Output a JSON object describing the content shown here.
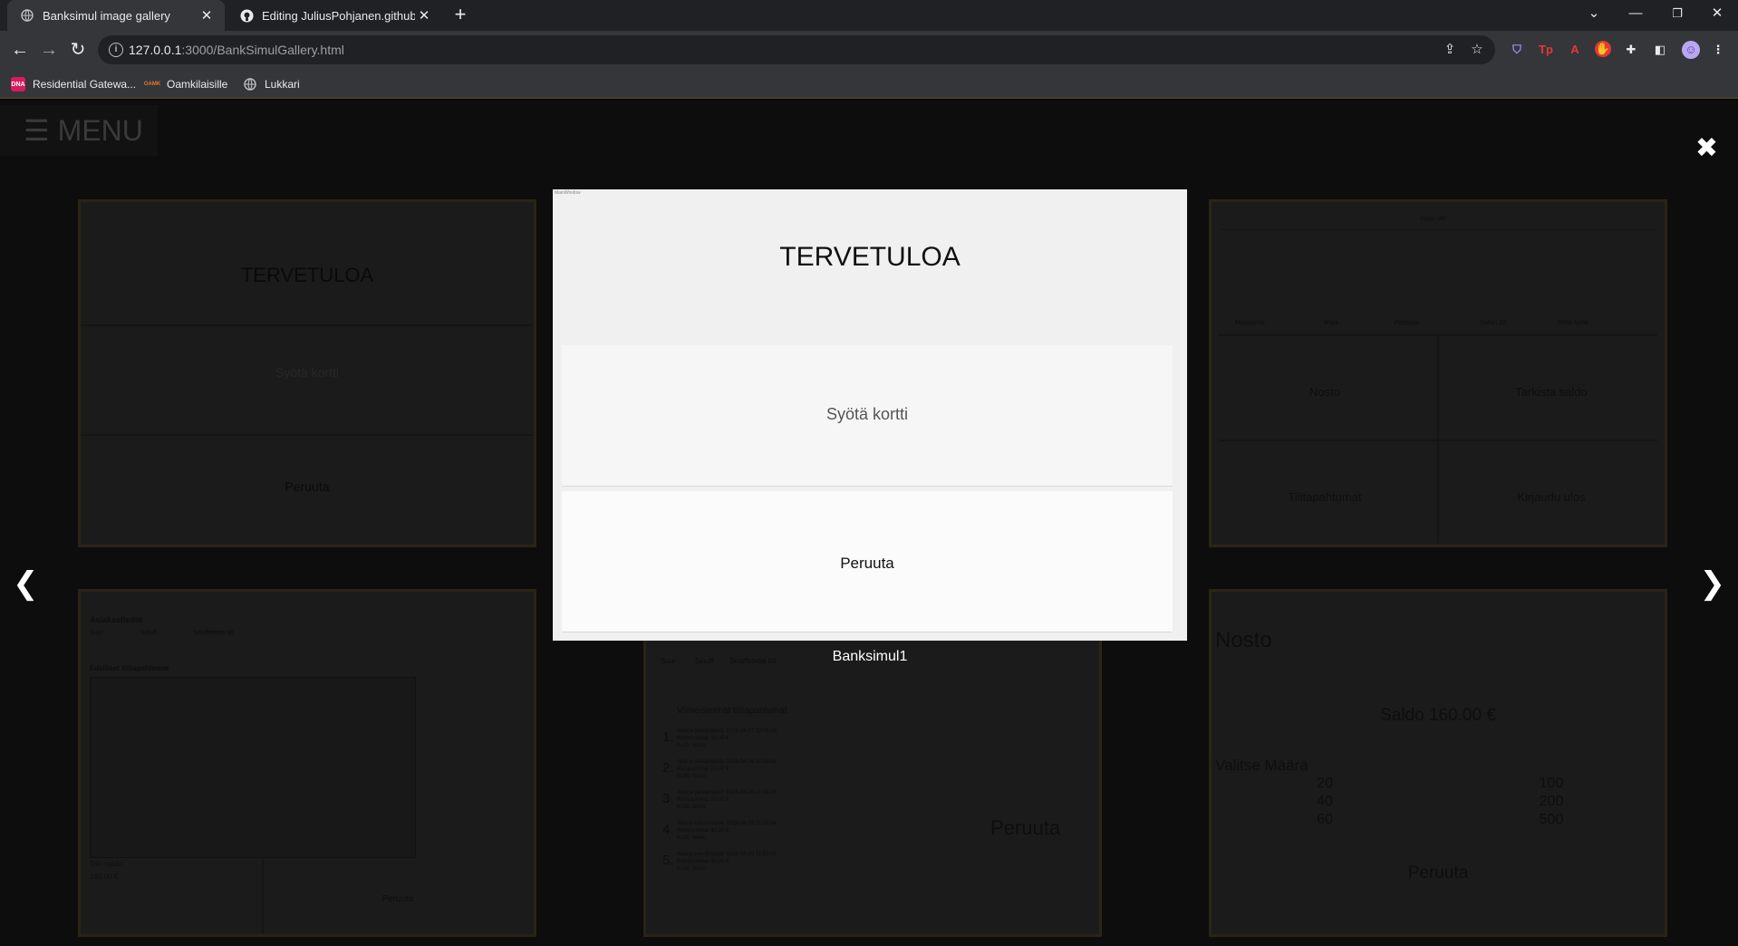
{
  "browser": {
    "tabs": [
      {
        "title": "Banksimul image gallery",
        "icon": "globe-icon"
      },
      {
        "title": "Editing JuliusPohjanen.github.io/",
        "icon": "github-icon"
      }
    ],
    "url_host": "127.0.0.1",
    "url_rest": ":3000/BankSimulGallery.html",
    "bookmarks": [
      {
        "label": "Residential Gatewa...",
        "icon": "DNA",
        "color": "#d81b60"
      },
      {
        "label": "Oamkilaisille",
        "icon": "OAMK",
        "color": "#e6762d"
      },
      {
        "label": "Lukkari",
        "icon": "globe-icon",
        "color": "#bdc1c6"
      }
    ]
  },
  "page": {
    "menu_label": "☰ MENU",
    "close_icon": "✖",
    "prev_icon": "❮",
    "next_icon": "❯",
    "caption": "Banksimul1"
  },
  "modal": {
    "window_title": "MainWindow",
    "title": "TERVETULOA",
    "insert_card": "Syötä kortti",
    "cancel": "Peruuta"
  },
  "thumbs": {
    "t1": {
      "title": "TERVETULOA",
      "insert": "Syötä kortti",
      "cancel": "Peruuta"
    },
    "t2": {
      "header": "Saldo: 160",
      "buttons": [
        "Nosto",
        "Tarkista saldo",
        "Tilitapahtumat",
        "Kirjaudu ulos"
      ],
      "weekdays": [
        "Maanantai",
        "Maja",
        "Perjantai",
        "Sallan 25",
        "Delta kortti"
      ]
    },
    "t3": {
      "title": "Asiakastiedot",
      "fields": [
        "Suur",
        "Sinuff",
        "Smsffeteba 60"
      ],
      "subtitle": "Edelliset tilitapahtumat",
      "balance_label": "Tilin saldo:",
      "balance": "160.00 €",
      "cancel": "Peruuta"
    },
    "t4": {
      "fields": [
        "Suur",
        "Sinuff",
        "Smsffeteba 60"
      ],
      "subtitle": "Viimeisimmät tilitapahtumat",
      "rows": [
        {
          "n": "1.",
          "l1": "Aika ja päivämäärä: 2023-04-27 13:06:16",
          "l2": "Rahasumma: 20.00 €",
          "l3": "Kuitti: Nosto"
        },
        {
          "n": "2.",
          "l1": "Aika ja päivämäärä: 2023-04-26 11:53:41",
          "l2": "Rahasumma: 20.00 €",
          "l3": "Kuitti: Nosto"
        },
        {
          "n": "3.",
          "l1": "Aika ja päivämäärä: 2023-04-25 11:58:28",
          "l2": "Rahasumma: 20.00 €",
          "l3": "Kuitti: Nosto"
        },
        {
          "n": "4.",
          "l1": "Aika ja päivämäärä: 2023-04-25 11:52:24",
          "l2": "Rahasumma: 40.00 €",
          "l3": "Kuitti: Nosto"
        },
        {
          "n": "5.",
          "l1": "Aika ja päivämäärä: 2023-04-25 11:52:15",
          "l2": "Rahasumma: 40.00 €",
          "l3": "Kuitti: Nosto"
        }
      ],
      "cancel": "Peruuta"
    },
    "t5": {
      "title": "Nosto",
      "saldo": "Saldo 160.00 €",
      "choose": "Valitse Määrä",
      "amounts_left": [
        "20",
        "40",
        "60"
      ],
      "amounts_right": [
        "100",
        "200",
        "500"
      ],
      "cancel": "Peruuta"
    }
  }
}
